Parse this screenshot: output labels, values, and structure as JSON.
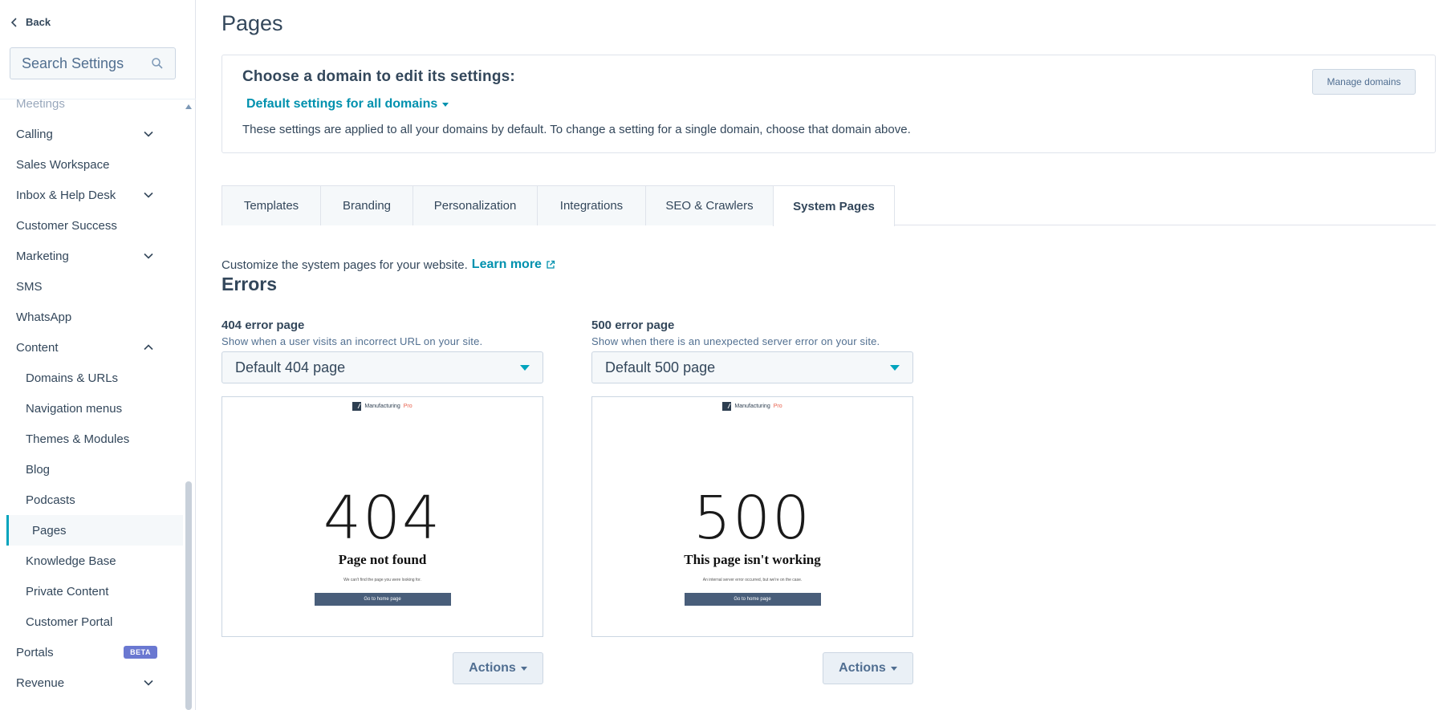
{
  "sidebar": {
    "back_label": "Back",
    "search_placeholder": "Search Settings",
    "items": [
      {
        "label": "Meetings"
      },
      {
        "label": "Calling"
      },
      {
        "label": "Sales Workspace"
      },
      {
        "label": "Inbox & Help Desk"
      },
      {
        "label": "Customer Success"
      },
      {
        "label": "Marketing"
      },
      {
        "label": "SMS"
      },
      {
        "label": "WhatsApp"
      },
      {
        "label": "Content"
      },
      {
        "label": "Domains & URLs"
      },
      {
        "label": "Navigation menus"
      },
      {
        "label": "Themes & Modules"
      },
      {
        "label": "Blog"
      },
      {
        "label": "Podcasts"
      },
      {
        "label": "Pages"
      },
      {
        "label": "Knowledge Base"
      },
      {
        "label": "Private Content"
      },
      {
        "label": "Customer Portal"
      },
      {
        "label": "Portals",
        "badge": "BETA"
      },
      {
        "label": "Revenue"
      }
    ]
  },
  "page": {
    "title": "Pages"
  },
  "domain_card": {
    "heading": "Choose a domain to edit its settings:",
    "selected_domain": "Default settings for all domains",
    "description": "These settings are applied to all your domains by default. To change a setting for a single domain, choose that domain above.",
    "manage_button": "Manage domains"
  },
  "tabs": [
    {
      "label": "Templates"
    },
    {
      "label": "Branding"
    },
    {
      "label": "Personalization"
    },
    {
      "label": "Integrations"
    },
    {
      "label": "SEO & Crawlers"
    },
    {
      "label": "System Pages",
      "active": true
    }
  ],
  "system_pages": {
    "intro": "Customize the system pages for your website.",
    "learn_more": "Learn more",
    "section_title": "Errors",
    "error_404": {
      "label": "404 error page",
      "help": "Show when a user visits an incorrect URL on your site.",
      "selected": "Default 404 page",
      "preview": {
        "brand": "Manufacturing",
        "brand_accent": "Pro",
        "code": "404",
        "message": "Page not found",
        "sub": "We can't find the page you were looking for.",
        "button": "Go to home page"
      },
      "actions_label": "Actions"
    },
    "error_500": {
      "label": "500 error page",
      "help": "Show when there is an unexpected server error on your site.",
      "selected": "Default 500 page",
      "preview": {
        "brand": "Manufacturing",
        "brand_accent": "Pro",
        "code": "500",
        "message": "This page isn't working",
        "sub": "An internal server error occurred, but we're on the case.",
        "button": "Go to home page"
      },
      "actions_label": "Actions"
    }
  },
  "colors": {
    "accent": "#00a4bd",
    "link": "#0091ae",
    "text": "#33475b",
    "beta_badge": "#6a78d1"
  }
}
